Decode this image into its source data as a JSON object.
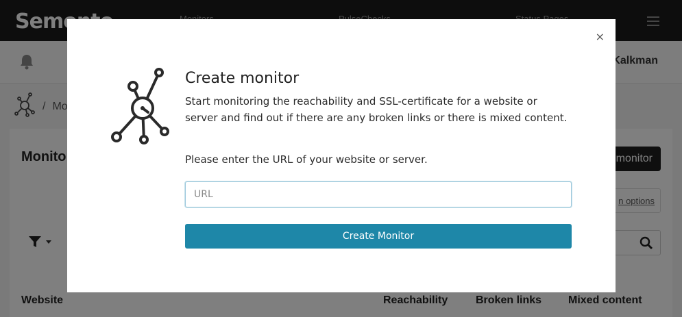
{
  "brand": {
    "name": "Semonto"
  },
  "topnav": {
    "links": [
      {
        "label": "Monitors"
      },
      {
        "label": "PulseChecks"
      },
      {
        "label": "Status Pages"
      }
    ]
  },
  "subbar": {
    "user_name": "Kalkman"
  },
  "breadcrumb": {
    "current": "Mo"
  },
  "card": {
    "title": "Monito",
    "add_button_label": "monitor",
    "options_link": "n options",
    "columns": [
      "Website",
      "Reachability",
      "Broken links",
      "Mixed content"
    ]
  },
  "modal": {
    "close_glyph": "×",
    "title": "Create monitor",
    "description": "Start monitoring the reachability and SSL-certificate for a website or server and find out if there are any broken links or there is mixed content.",
    "prompt": "Please enter the URL of your website or server.",
    "url_input": {
      "value": "",
      "placeholder": "URL"
    },
    "submit_label": "Create Monitor"
  },
  "colors": {
    "topnav_bg": "#1b1b1b",
    "primary": "#1e87a8",
    "overlay": "rgba(0,0,0,0.5)"
  }
}
